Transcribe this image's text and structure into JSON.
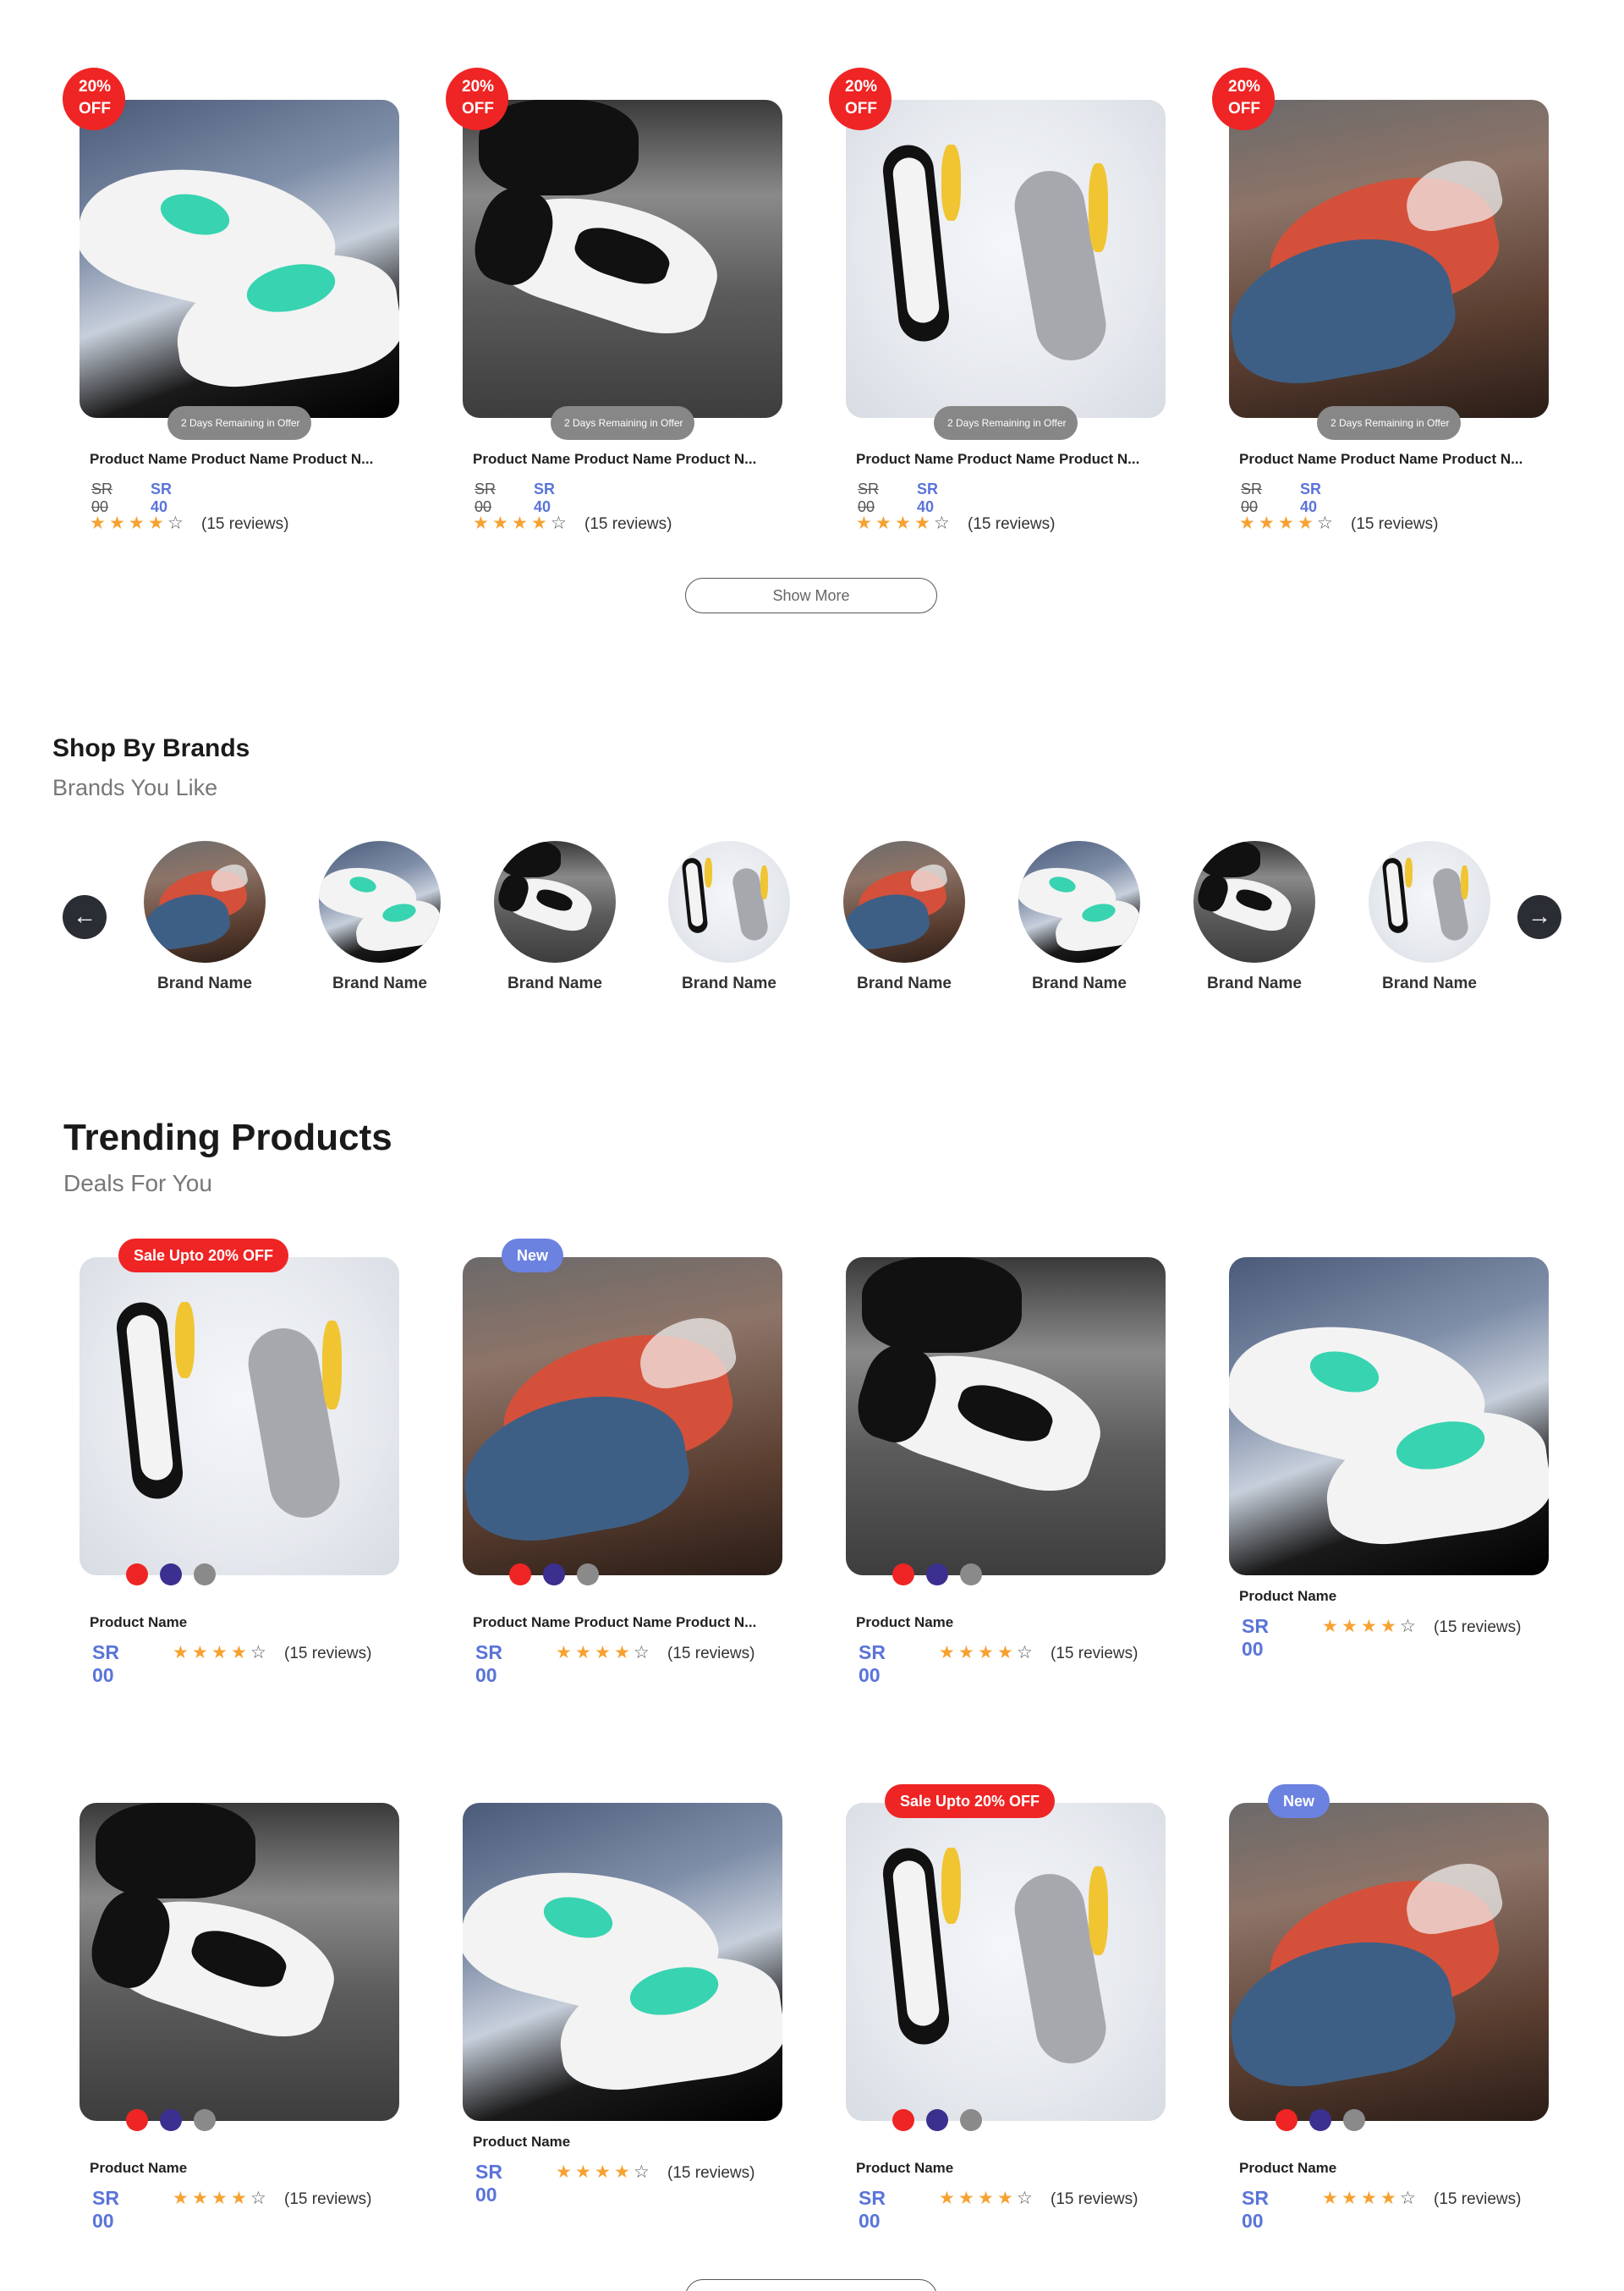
{
  "colors": {
    "accent": "#5a74d8",
    "sale_red": "#ef2424",
    "new_blue": "#6b82e0",
    "star": "#f7a131"
  },
  "offers": {
    "items": [
      {
        "badge": "20% OFF",
        "badge_l1": "20%",
        "badge_l2": "OFF",
        "remaining": "2 Days Remaining in Offer",
        "name": "Product Name Product Name Product N...",
        "old_price": "SR 00",
        "price": "SR 40",
        "rating": 4,
        "reviews": "(15 reviews)",
        "image": "white-teal-sneaker"
      },
      {
        "badge": "20% OFF",
        "badge_l1": "20%",
        "badge_l2": "OFF",
        "remaining": "2 Days Remaining in Offer",
        "name": "Product Name Product Name Product N...",
        "old_price": "SR 00",
        "price": "SR 40",
        "rating": 4,
        "reviews": "(15 reviews)",
        "image": "black-white-dunk"
      },
      {
        "badge": "20% OFF",
        "badge_l1": "20%",
        "badge_l2": "OFF",
        "remaining": "2 Days Remaining in Offer",
        "name": "Product Name Product Name Product N...",
        "old_price": "SR 00",
        "price": "SR 40",
        "rating": 4,
        "reviews": "(15 reviews)",
        "image": "grey-yellow-runner"
      },
      {
        "badge": "20% OFF",
        "badge_l1": "20%",
        "badge_l2": "OFF",
        "remaining": "2 Days Remaining in Offer",
        "name": "Product Name Product Name Product N...",
        "old_price": "SR 00",
        "price": "SR 40",
        "rating": 4,
        "reviews": "(15 reviews)",
        "image": "blue-red-loafers"
      }
    ],
    "show_more": "Show More"
  },
  "brands": {
    "title": "Shop By Brands",
    "subtitle": "Brands You Like",
    "prev_icon": "arrow-left-icon",
    "next_icon": "arrow-right-icon",
    "items": [
      {
        "name": "Brand Name",
        "image": "blue-red-loafers"
      },
      {
        "name": "Brand Name",
        "image": "white-teal-sneaker"
      },
      {
        "name": "Brand Name",
        "image": "black-white-dunk"
      },
      {
        "name": "Brand Name",
        "image": "grey-yellow-runner"
      },
      {
        "name": "Brand Name",
        "image": "blue-red-loafers"
      },
      {
        "name": "Brand Name",
        "image": "white-teal-sneaker"
      },
      {
        "name": "Brand Name",
        "image": "black-white-dunk"
      },
      {
        "name": "Brand Name",
        "image": "grey-yellow-runner"
      }
    ]
  },
  "trending": {
    "title": "Trending Products",
    "subtitle": "Deals For You",
    "sale_label": "Sale Upto 20% OFF",
    "new_label": "New",
    "swatch_colors": [
      "#ef2424",
      "#3b2f8f",
      "#8a8a8a"
    ],
    "items": [
      {
        "tag": "sale",
        "name": "Product Name",
        "price": "SR 00",
        "rating": 4,
        "reviews": "(15 reviews)",
        "swatches": true,
        "image": "grey-yellow-runner"
      },
      {
        "tag": "new",
        "name": "Product Name Product Name Product N...",
        "price": "SR 00",
        "rating": 4,
        "reviews": "(15 reviews)",
        "swatches": true,
        "image": "blue-red-loafers"
      },
      {
        "tag": "",
        "name": "Product Name",
        "price": "SR 00",
        "rating": 4,
        "reviews": "(15 reviews)",
        "swatches": true,
        "image": "black-white-dunk"
      },
      {
        "tag": "",
        "name": "Product Name",
        "price": "SR 00",
        "rating": 4,
        "reviews": "(15 reviews)",
        "swatches": false,
        "image": "white-teal-sneaker"
      },
      {
        "tag": "",
        "name": "Product Name",
        "price": "SR 00",
        "rating": 4,
        "reviews": "(15 reviews)",
        "swatches": true,
        "image": "black-white-dunk"
      },
      {
        "tag": "",
        "name": "Product Name",
        "price": "SR 00",
        "rating": 4,
        "reviews": "(15 reviews)",
        "swatches": false,
        "image": "white-teal-sneaker"
      },
      {
        "tag": "sale",
        "name": "Product Name",
        "price": "SR 00",
        "rating": 4,
        "reviews": "(15 reviews)",
        "swatches": true,
        "image": "grey-yellow-runner"
      },
      {
        "tag": "new",
        "name": "Product Name",
        "price": "SR 00",
        "rating": 4,
        "reviews": "(15 reviews)",
        "swatches": true,
        "image": "blue-red-loafers"
      }
    ]
  }
}
